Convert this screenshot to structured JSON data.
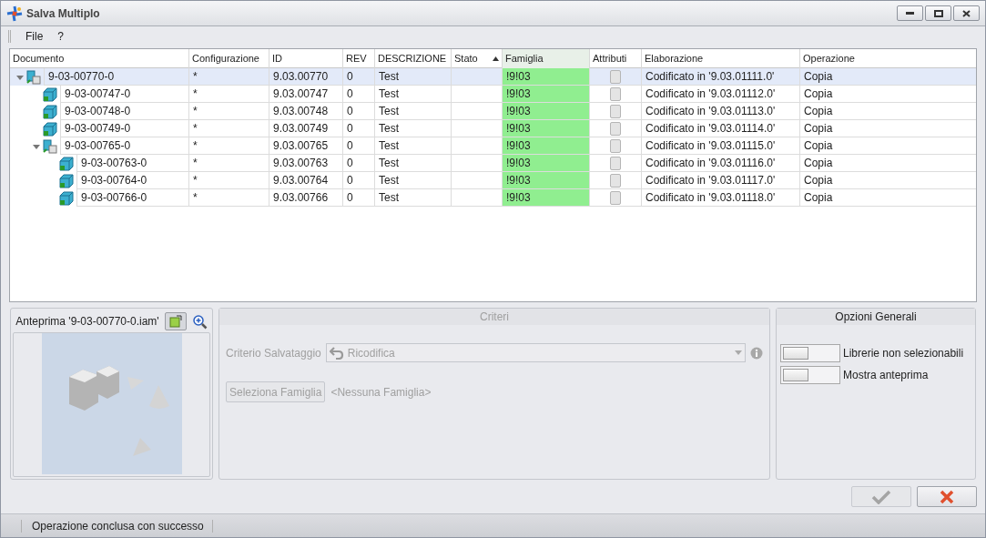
{
  "window": {
    "title": "Salva Multiplo"
  },
  "menu": [
    "File",
    "?"
  ],
  "table": {
    "columns": [
      {
        "label": "Documento",
        "sorted": false
      },
      {
        "label": "Configurazione",
        "sorted": false
      },
      {
        "label": "ID",
        "sorted": false
      },
      {
        "label": "REV",
        "sorted": false
      },
      {
        "label": "DESCRIZIONE",
        "sorted": false
      },
      {
        "label": "Stato",
        "sorted": true
      },
      {
        "label": "Famiglia",
        "sorted": false
      },
      {
        "label": "Attributi",
        "sorted": false
      },
      {
        "label": "Elaborazione",
        "sorted": false
      },
      {
        "label": "Operazione",
        "sorted": false
      }
    ],
    "rows": [
      {
        "kind": "assembly",
        "expanded": true,
        "selected": true,
        "documento": "9-03-00770-0",
        "configurazione": "*",
        "id": "9.03.00770",
        "rev": "0",
        "descrizione": "Test",
        "famiglia": "!9!03",
        "attributi": false,
        "elaborazione": "Codificato in '9.03.01111.0'",
        "operazione": "Copia",
        "children": [
          {
            "kind": "part",
            "selected": false,
            "documento": "9-03-00747-0",
            "configurazione": "*",
            "id": "9.03.00747",
            "rev": "0",
            "descrizione": "Test",
            "famiglia": "!9!03",
            "attributi": false,
            "elaborazione": "Codificato in '9.03.01112.0'",
            "operazione": "Copia"
          },
          {
            "kind": "part",
            "selected": false,
            "documento": "9-03-00748-0",
            "configurazione": "*",
            "id": "9.03.00748",
            "rev": "0",
            "descrizione": "Test",
            "famiglia": "!9!03",
            "attributi": false,
            "elaborazione": "Codificato in '9.03.01113.0'",
            "operazione": "Copia"
          },
          {
            "kind": "part",
            "selected": false,
            "documento": "9-03-00749-0",
            "configurazione": "*",
            "id": "9.03.00749",
            "rev": "0",
            "descrizione": "Test",
            "famiglia": "!9!03",
            "attributi": false,
            "elaborazione": "Codificato in '9.03.01114.0'",
            "operazione": "Copia"
          },
          {
            "kind": "assembly",
            "expanded": true,
            "selected": false,
            "documento": "9-03-00765-0",
            "configurazione": "*",
            "id": "9.03.00765",
            "rev": "0",
            "descrizione": "Test",
            "famiglia": "!9!03",
            "attributi": false,
            "elaborazione": "Codificato in '9.03.01115.0'",
            "operazione": "Copia",
            "children": [
              {
                "kind": "part",
                "selected": false,
                "documento": "9-03-00763-0",
                "configurazione": "*",
                "id": "9.03.00763",
                "rev": "0",
                "descrizione": "Test",
                "famiglia": "!9!03",
                "attributi": false,
                "elaborazione": "Codificato in '9.03.01116.0'",
                "operazione": "Copia"
              },
              {
                "kind": "part",
                "selected": false,
                "documento": "9-03-00764-0",
                "configurazione": "*",
                "id": "9.03.00764",
                "rev": "0",
                "descrizione": "Test",
                "famiglia": "!9!03",
                "attributi": false,
                "elaborazione": "Codificato in '9.03.01117.0'",
                "operazione": "Copia"
              },
              {
                "kind": "part",
                "selected": false,
                "documento": "9-03-00766-0",
                "configurazione": "*",
                "id": "9.03.00766",
                "rev": "0",
                "descrizione": "Test",
                "famiglia": "!9!03",
                "attributi": false,
                "elaborazione": "Codificato in '9.03.01118.0'",
                "operazione": "Copia"
              }
            ]
          }
        ]
      }
    ]
  },
  "preview": {
    "title": "Anteprima '9-03-00770-0.iam'",
    "fit_toggle_on": true
  },
  "criteri": {
    "title": "Criteri",
    "disabled": true,
    "criterio_label": "Criterio Salvataggio",
    "criterio_value": "Ricodifica",
    "famiglia_button": "Seleziona Famiglia",
    "famiglia_value": "<Nessuna Famiglia>"
  },
  "opzioni": {
    "title": "Opzioni Generali",
    "toggles": [
      {
        "label": "Librerie non selezionabili",
        "on": false
      },
      {
        "label": "Mostra anteprima",
        "on": false
      }
    ]
  },
  "status_bar": "Operazione conclusa con successo"
}
